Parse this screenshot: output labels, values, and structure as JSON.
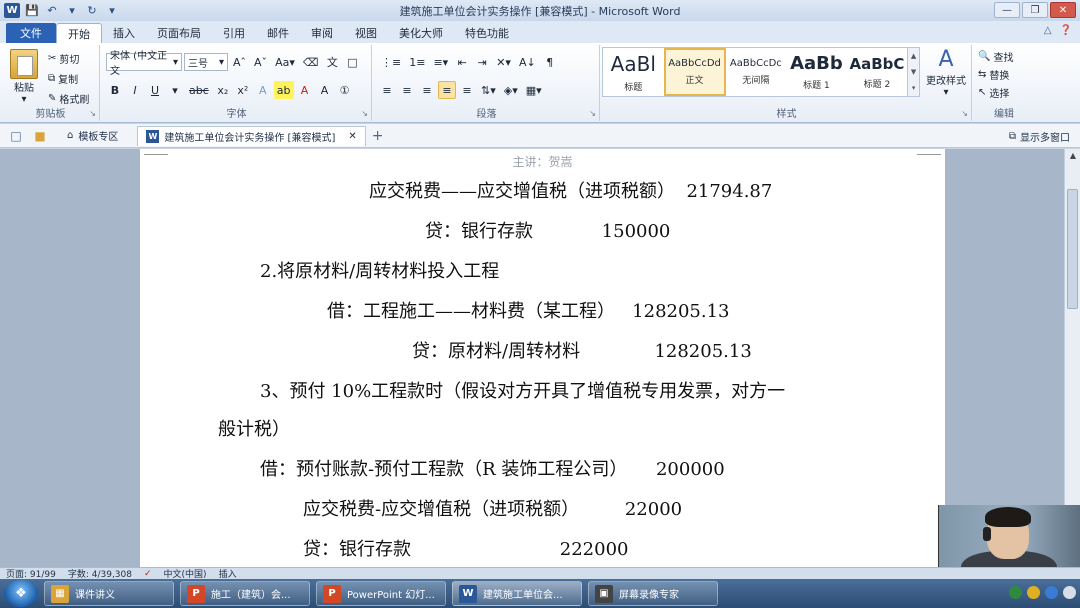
{
  "window": {
    "title": "建筑施工单位会计实务操作 [兼容模式] - Microsoft Word"
  },
  "ribbon_tabs": [
    "文件",
    "开始",
    "插入",
    "页面布局",
    "引用",
    "邮件",
    "审阅",
    "视图",
    "美化大师",
    "特色功能"
  ],
  "clipboard": {
    "paste": "粘贴",
    "cut": "剪切",
    "copy": "复制",
    "format_painter": "格式刷",
    "group_label": "剪贴板"
  },
  "font": {
    "family": "宋体 (中文正文",
    "size": "三号",
    "group_label": "字体"
  },
  "paragraph": {
    "group_label": "段落"
  },
  "styles": {
    "items": [
      {
        "sample": "AaBl",
        "name": "标题"
      },
      {
        "sample": "AaBbCcDd",
        "name": "正文"
      },
      {
        "sample": "AaBbCcDc",
        "name": "无间隔"
      },
      {
        "sample": "AaBb",
        "name": "标题 1"
      },
      {
        "sample": "AaBbC",
        "name": "标题 2"
      }
    ],
    "change_styles": "更改样式",
    "group_label": "样式"
  },
  "editing": {
    "find": "查找",
    "replace": "替换",
    "select": "选择",
    "group_label": "编辑"
  },
  "doc_tabs": {
    "templates": "模板专区",
    "active_doc": "建筑施工单位会计实务操作 [兼容模式]",
    "multi_window": "显示多窗口"
  },
  "document": {
    "header": "主讲：贺嵩",
    "lines": [
      "应交税费——应交增值税（进项税额）  21794.87",
      "贷：银行存款            150000",
      "2.将原材料/周转材料投入工程",
      "借：工程施工——材料费（某工程）   128205.13",
      "贷：原材料/周转材料             128205.13",
      "3、预付 10%工程款时（假设对方开具了增值税专用发票，对方一",
      "般计税）",
      "借：预付账款-预付工程款（R 装饰工程公司）     200000",
      "应交税费-应交增值税（进项税额）        22000",
      "贷：银行存款                          222000"
    ]
  },
  "status": {
    "page": "页面: 91/99",
    "words": "字数: 4/39,308",
    "language": "中文(中国)",
    "mode": "插入"
  },
  "taskbar": {
    "items": [
      {
        "label": "课件讲义",
        "icon": "folder-icon",
        "color": "#d9a53a"
      },
      {
        "label": "施工（建筑）会...",
        "icon": "powerpoint-icon",
        "color": "#d24726"
      },
      {
        "label": "PowerPoint 幻灯...",
        "icon": "powerpoint-icon",
        "color": "#d24726"
      },
      {
        "label": "建筑施工单位会...",
        "icon": "word-icon",
        "color": "#2b5797"
      },
      {
        "label": "屏幕录像专家",
        "icon": "recorder-icon",
        "color": "#444444"
      }
    ]
  }
}
